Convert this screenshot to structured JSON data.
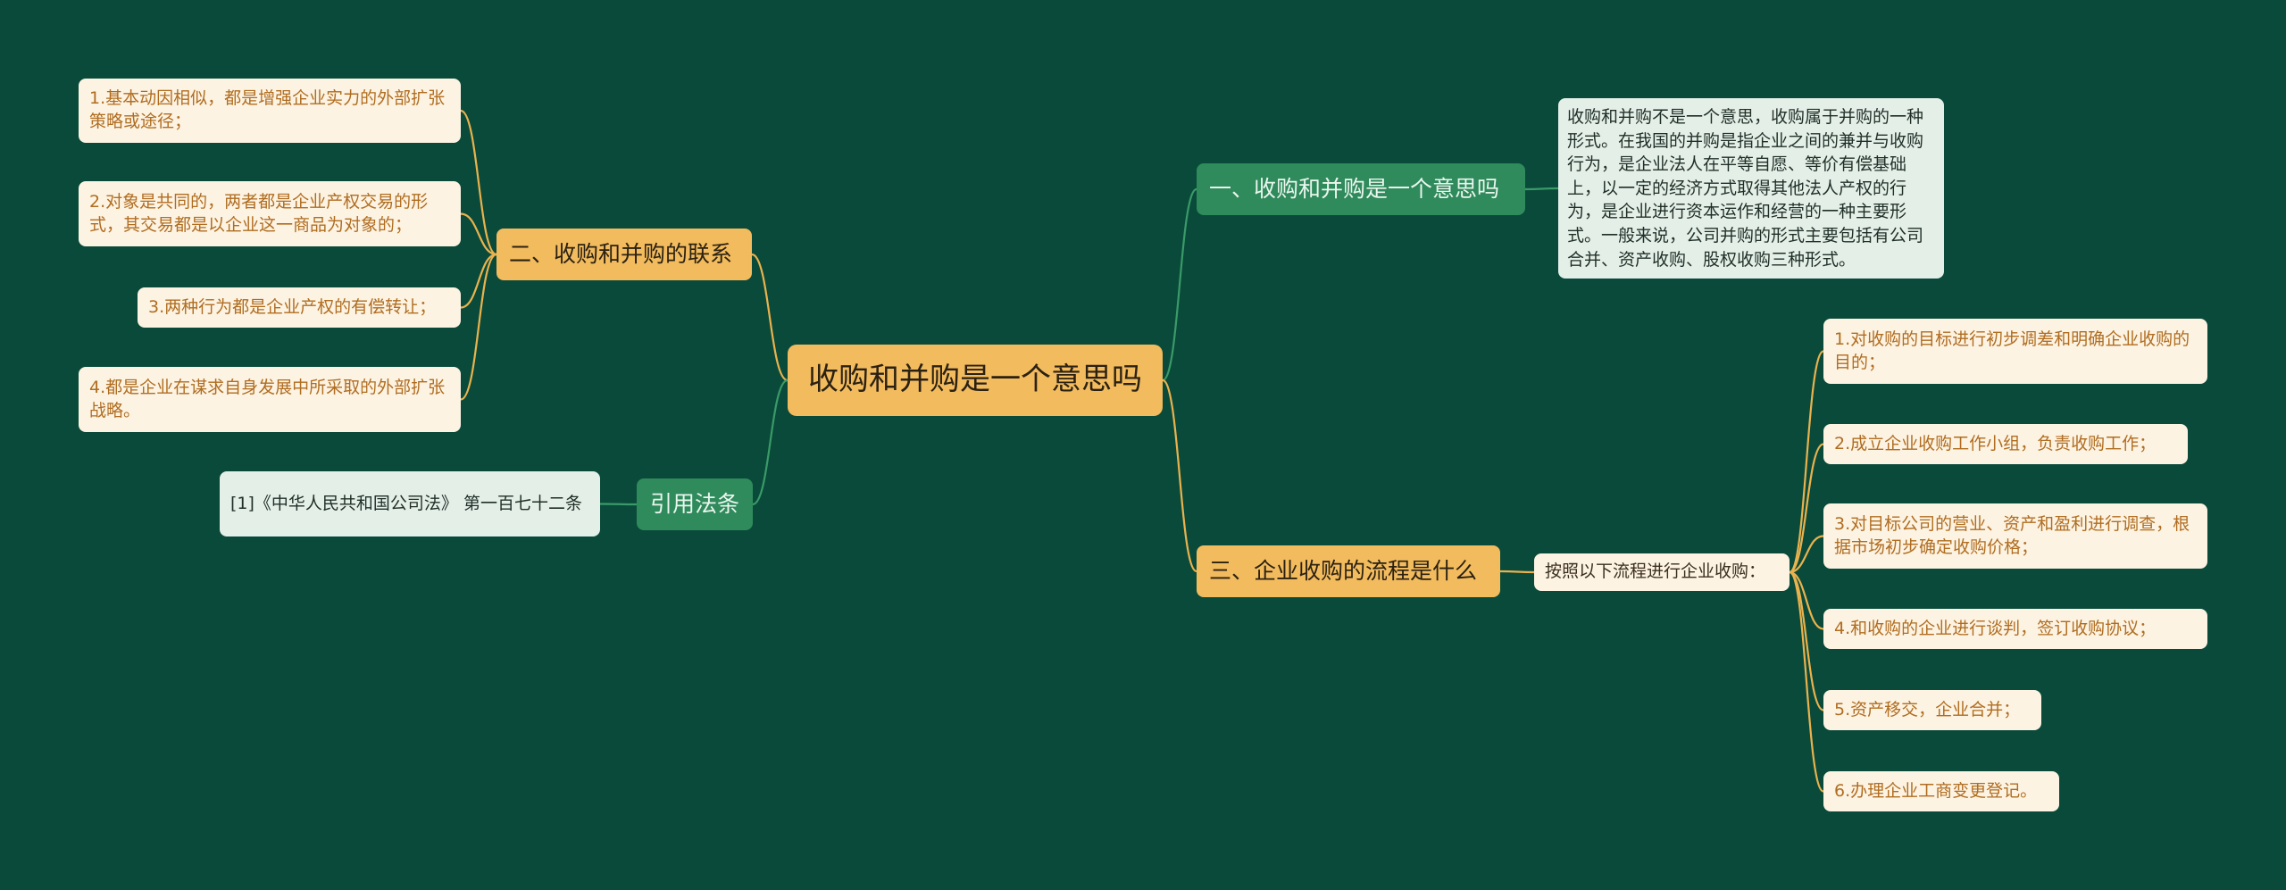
{
  "root": {
    "label": "收购和并购是一个意思吗"
  },
  "branches": {
    "b1": {
      "label": "一、收购和并购是一个意思吗",
      "desc": "收购和并购不是一个意思，收购属于并购的一种形式。在我国的并购是指企业之间的兼并与收购行为，是企业法人在平等自愿、等价有偿基础上，以一定的经济方式取得其他法人产权的行为，是企业进行资本运作和经营的一种主要形式。一般来说，公司并购的形式主要包括有公司合并、资产收购、股权收购三种形式。"
    },
    "b2": {
      "label": "二、收购和并购的联系",
      "items": [
        "1.基本动因相似，都是增强企业实力的外部扩张策略或途径；",
        "2.对象是共同的，两者都是企业产权交易的形式，其交易都是以企业这一商品为对象的；",
        "3.两种行为都是企业产权的有偿转让；",
        "4.都是企业在谋求自身发展中所采取的外部扩张战略。"
      ]
    },
    "b3": {
      "label": "三、企业收购的流程是什么",
      "intro": "按照以下流程进行企业收购：",
      "steps": [
        "1.对收购的目标进行初步调差和明确企业收购的目的；",
        "2.成立企业收购工作小组，负责收购工作；",
        "3.对目标公司的营业、资产和盈利进行调查，根据市场初步确定收购价格；",
        "4.和收购的企业进行谈判，签订收购协议；",
        "5.资产移交，企业合并；",
        "6.办理企业工商变更登记。"
      ]
    },
    "ref": {
      "label": "引用法条",
      "item": "[1]《中华人民共和国公司法》 第一百七十二条"
    }
  },
  "colors": {
    "background": "#0a4a3a",
    "orange_node": "#f2bb5e",
    "green_node": "#2f8a5c",
    "cream_leaf": "#fdf3e3",
    "mint_leaf": "#e4efe8",
    "orange_link": "#e9b24e",
    "green_link": "#3a9a68"
  }
}
